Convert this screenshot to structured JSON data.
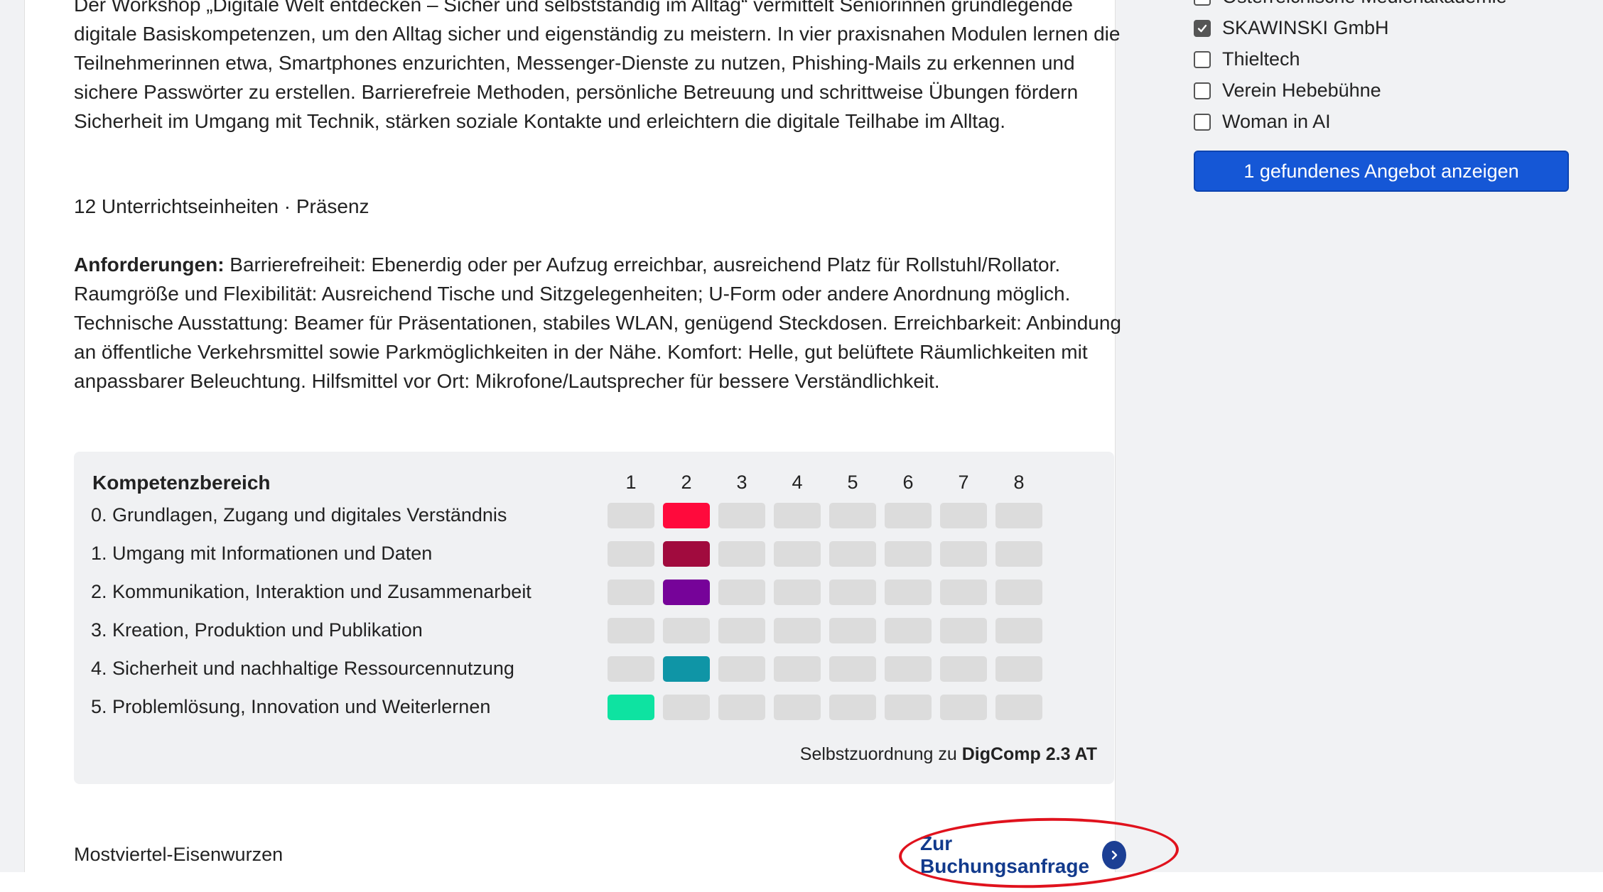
{
  "course": {
    "description": "Der Workshop „Digitale Welt entdecken – Sicher und selbstständig im Alltag“ vermittelt Seniorinnen grundlegende digitale Basiskompetenzen, um den Alltag sicher und eigenständig zu meistern. In vier praxisnahen Modulen lernen die Teilnehmerinnen etwa, Smartphones enzurichten, Messenger-Dienste zu nutzen, Phishing-Mails zu erkennen und sichere Passwörter zu erstellen. Barrierefreie Methoden, persönliche Betreuung und schrittweise Übungen fördern Sicherheit im Umgang mit Technik, stärken soziale Kontakte und erleichtern die digitale Teilhabe im Alltag.",
    "meta": "12 Unterrichtseinheiten · Präsenz",
    "requirements_label": "Anforderungen:",
    "requirements_text": " Barrierefreiheit: Ebenerdig oder per Aufzug erreichbar, ausreichend Platz für Rollstuhl/Rollator. Raumgröße und Flexibilität: Ausreichend Tische und Sitzgelegenheiten; U-Form oder andere Anordnung möglich. Technische Ausstattung: Beamer für Präsentationen, stabiles WLAN, genügend Steckdosen. Erreichbarkeit: Anbindung an öffentliche Verkehrsmittel sowie Parkmöglichkeiten in der Nähe. Komfort: Helle, gut belüftete Räumlichkeiten mit anpassbarer Beleuchtung. Hilfsmittel vor Ort: Mikrofone/Lautsprecher für bessere Verständlichkeit."
  },
  "competence": {
    "title": "Kompetenzbereich",
    "levels": [
      "1",
      "2",
      "3",
      "4",
      "5",
      "6",
      "7",
      "8"
    ],
    "rows": [
      {
        "label": "0. Grundlagen, Zugang und digitales Verständnis",
        "level": 2,
        "color": "#ff0a3c"
      },
      {
        "label": "1. Umgang mit Informationen und Daten",
        "level": 2,
        "color": "#a10b3e"
      },
      {
        "label": "2. Kommunikation, Interaktion und Zusammenarbeit",
        "level": 2,
        "color": "#760399"
      },
      {
        "label": "3. Kreation, Produktion und Publikation",
        "level": 0,
        "color": "#dcdcdc"
      },
      {
        "label": "4. Sicherheit und nachhaltige Ressourcennutzung",
        "level": 2,
        "color": "#0f95a6"
      },
      {
        "label": "5. Problemlösung, Innovation und Weiterlernen",
        "level": 1,
        "color": "#0ee3a1"
      }
    ],
    "footer_prefix": "Selbstzuordnung zu ",
    "footer_bold": "DigComp 2.3 AT"
  },
  "footer": {
    "region": "Mostviertel-Eisenwurzen",
    "booking_label": "Zur Buchungsanfrage",
    "booking_icon": "chevron-right-icon"
  },
  "sidebar": {
    "filters": [
      {
        "label": "Österreichische Medienakademie",
        "checked": false
      },
      {
        "label": "SKAWINSKI GmbH",
        "checked": true
      },
      {
        "label": "Thieltech",
        "checked": false
      },
      {
        "label": "Verein Hebebühne",
        "checked": false
      },
      {
        "label": "Woman in AI",
        "checked": false
      }
    ],
    "show_button": "1 gefundenes Angebot anzeigen"
  },
  "colors": {
    "inactive_cell": "#dcdcdc",
    "primary_button": "#1557d6",
    "booking_link": "#123a8c",
    "annotation": "#e0121d"
  }
}
